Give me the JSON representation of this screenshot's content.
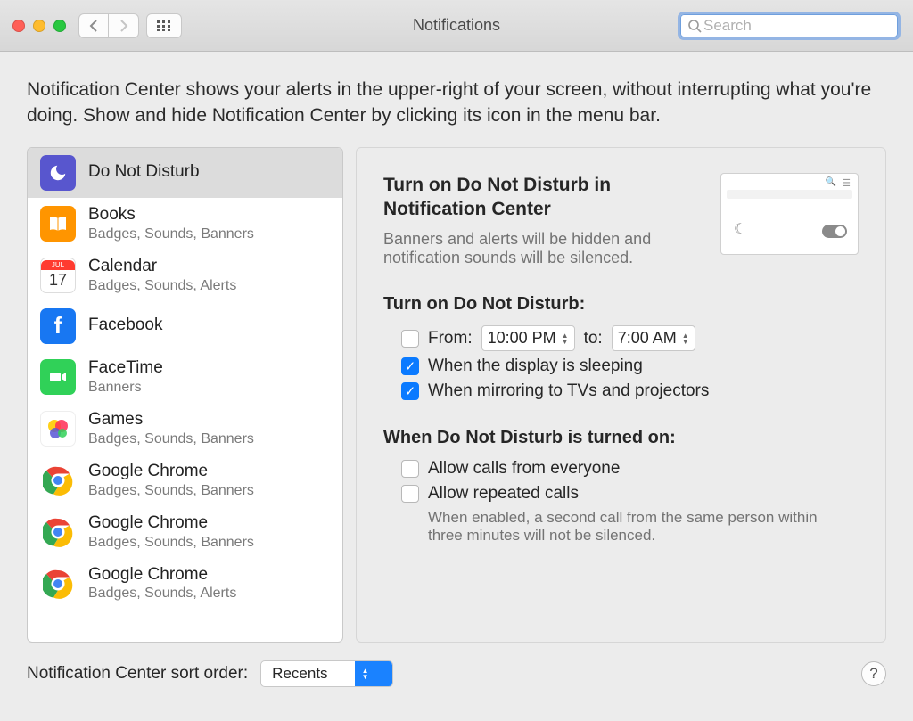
{
  "window": {
    "title": "Notifications",
    "search_placeholder": "Search"
  },
  "intro": "Notification Center shows your alerts in the upper-right of your screen, without interrupting what you're doing. Show and hide Notification Center by clicking its icon in the menu bar.",
  "sidebar": {
    "items": [
      {
        "name": "Do Not Disturb",
        "sub": "",
        "icon": "moon",
        "selected": true
      },
      {
        "name": "Books",
        "sub": "Badges, Sounds, Banners",
        "icon": "books"
      },
      {
        "name": "Calendar",
        "sub": "Badges, Sounds, Alerts",
        "icon": "cal"
      },
      {
        "name": "Facebook",
        "sub": "",
        "icon": "fb"
      },
      {
        "name": "FaceTime",
        "sub": "Banners",
        "icon": "ft"
      },
      {
        "name": "Games",
        "sub": "Badges, Sounds, Banners",
        "icon": "games"
      },
      {
        "name": "Google Chrome",
        "sub": "Badges, Sounds, Banners",
        "icon": "chrome"
      },
      {
        "name": "Google Chrome",
        "sub": "Badges, Sounds, Banners",
        "icon": "chrome"
      },
      {
        "name": "Google Chrome",
        "sub": "Badges, Sounds, Alerts",
        "icon": "chrome"
      }
    ]
  },
  "detail": {
    "heading": "Turn on Do Not Disturb in Notification Center",
    "subtext": "Banners and alerts will be hidden and notification sounds will be silenced.",
    "section1": "Turn on Do Not Disturb:",
    "from_label": "From:",
    "from_value": "10:00 PM",
    "to_label": "to:",
    "to_value": "7:00 AM",
    "opt_sleeping": "When the display is sleeping",
    "opt_mirroring": "When mirroring to TVs and projectors",
    "section2": "When Do Not Disturb is turned on:",
    "opt_everyone": "Allow calls from everyone",
    "opt_repeated": "Allow repeated calls",
    "repeated_help": "When enabled, a second call from the same person within three minutes will not be silenced."
  },
  "footer": {
    "label": "Notification Center sort order:",
    "value": "Recents"
  }
}
